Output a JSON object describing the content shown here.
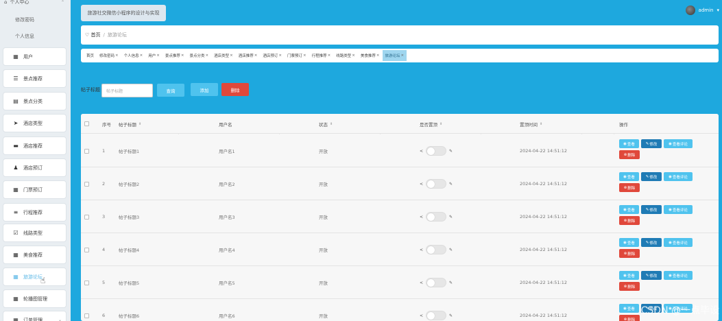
{
  "sidebar": {
    "group_label": "个人中心",
    "sub_items": [
      "修改密码",
      "个人信息"
    ],
    "items": [
      {
        "label": "用户",
        "icon": "grid-icon"
      },
      {
        "label": "景点推荐",
        "icon": "list-icon"
      },
      {
        "label": "景点分类",
        "icon": "clipboard-icon"
      },
      {
        "label": "酒店类型",
        "icon": "send-icon"
      },
      {
        "label": "酒店推荐",
        "icon": "hotel-icon"
      },
      {
        "label": "酒店预订",
        "icon": "person-icon"
      },
      {
        "label": "门票预订",
        "icon": "grid-icon"
      },
      {
        "label": "行程推荐",
        "icon": "menu-icon"
      },
      {
        "label": "线路类型",
        "icon": "checkbox-icon"
      },
      {
        "label": "美食推荐",
        "icon": "grid-icon"
      },
      {
        "label": "旅游论坛",
        "icon": "grid-icon"
      },
      {
        "label": "轮播图管理",
        "icon": "grid-icon"
      },
      {
        "label": "订单管理",
        "icon": "grid-icon"
      }
    ]
  },
  "header": {
    "app_title": "旅游社交微信小程序的设计与实现",
    "user_name": "admin",
    "user_caret": "▾"
  },
  "breadcrumb": {
    "home": "首页",
    "separator": "/",
    "current": "旅游论坛"
  },
  "tags": [
    {
      "label": "首页"
    },
    {
      "label": "修改密码"
    },
    {
      "label": "个人信息"
    },
    {
      "label": "用户"
    },
    {
      "label": "景点推荐"
    },
    {
      "label": "景点分类"
    },
    {
      "label": "酒店类型"
    },
    {
      "label": "酒店推荐"
    },
    {
      "label": "酒店预订"
    },
    {
      "label": "门票预订"
    },
    {
      "label": "行程推荐"
    },
    {
      "label": "线路类型"
    },
    {
      "label": "美食推荐"
    },
    {
      "label": "旅游论坛",
      "active": true
    }
  ],
  "search": {
    "label": "帖子标题",
    "placeholder": "帖子标题",
    "query_label": "查询",
    "add_label": "添加",
    "delete_label": "删除"
  },
  "table": {
    "headers": {
      "index": "序号",
      "title": "帖子标题",
      "username": "用户名",
      "status": "状态",
      "pinned": "是否置顶",
      "pinned_time": "置顶时间",
      "ops": "操作"
    },
    "rows": [
      {
        "index": "1",
        "title": "帖子标题1",
        "username": "用户名1",
        "status": "开放",
        "time": "2024-04-22 14:51:12"
      },
      {
        "index": "2",
        "title": "帖子标题2",
        "username": "用户名2",
        "status": "开放",
        "time": "2024-04-22 14:51:12"
      },
      {
        "index": "3",
        "title": "帖子标题3",
        "username": "用户名3",
        "status": "开放",
        "time": "2024-04-22 14:51:12"
      },
      {
        "index": "4",
        "title": "帖子标题4",
        "username": "用户名4",
        "status": "开放",
        "time": "2024-04-22 14:51:12"
      },
      {
        "index": "5",
        "title": "帖子标题5",
        "username": "用户名5",
        "status": "开放",
        "time": "2024-04-22 14:51:12"
      },
      {
        "index": "6",
        "title": "帖子标题6",
        "username": "用户名6",
        "status": "开放",
        "time": "2024-04-22 14:51:12"
      }
    ],
    "op_labels": {
      "view": "查看",
      "edit": "修改",
      "review": "查看评论",
      "delete": "删除"
    }
  },
  "watermark": "CSDN @一点毕设",
  "colors": {
    "primary": "#1ea8de",
    "accent": "#4fc3ee",
    "danger": "#e0483b",
    "edit": "#1f7bb5"
  }
}
